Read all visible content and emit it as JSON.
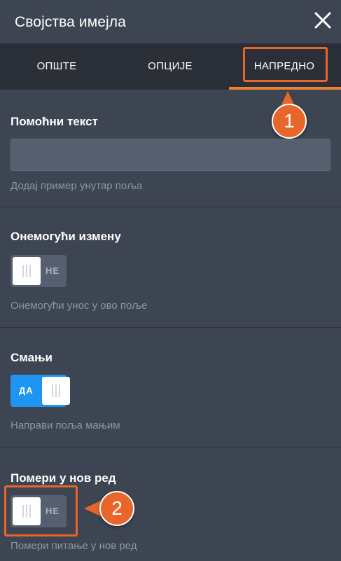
{
  "dialog": {
    "title": "Својства имејла",
    "close_icon": "close-icon"
  },
  "tabs": [
    {
      "label": "ОПШТЕ",
      "active": false
    },
    {
      "label": "ОПЦИЈЕ",
      "active": false
    },
    {
      "label": "НАПРЕДНО",
      "active": true
    }
  ],
  "fields": {
    "hint_text": {
      "label": "Помоћни текст",
      "value": "",
      "placeholder": "",
      "help": "Додај пример унутар поља"
    },
    "disable_editing": {
      "label": "Онемогући измену",
      "state_label": "НЕ",
      "on": false,
      "help": "Онемогући унос у ово поље"
    },
    "shrink": {
      "label": "Смањи",
      "state_label": "ДА",
      "on": true,
      "help": "Направи поља мањим"
    },
    "move_new_line": {
      "label": "Помери у нов ред",
      "state_label": "НЕ",
      "on": false,
      "help": "Помери питање у нов ред"
    }
  },
  "annotations": {
    "callout_1": "1",
    "callout_2": "2"
  },
  "colors": {
    "panel_bg": "#3d4452",
    "tabs_bg": "#2a2f38",
    "accent_orange": "#e8662a",
    "toggle_on": "#1f95f2",
    "toggle_off": "#555f70"
  }
}
